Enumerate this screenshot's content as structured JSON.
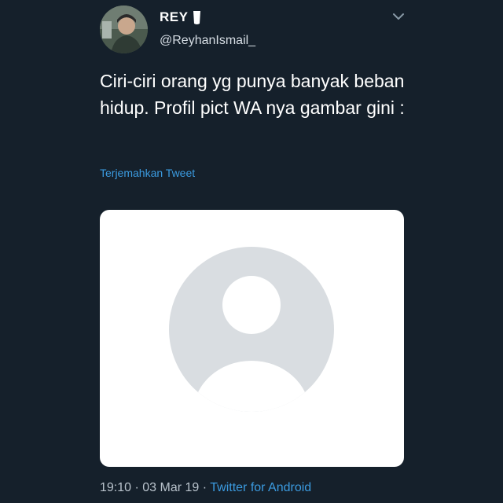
{
  "user": {
    "display_name": "REY",
    "name_emoji_icon": "cup-emoji-icon",
    "handle": "@ReyhanIsmail_"
  },
  "tweet": {
    "text": "Ciri-ciri orang yg punya banyak beban hidup. Profil pict WA nya gambar gini :",
    "translate_label": "Terjemahkan Tweet",
    "media_icon": "default-profile-placeholder-icon"
  },
  "footer": {
    "time": "19:10",
    "separator1": " · ",
    "date": "03 Mar 19",
    "separator2": " · ",
    "source": "Twitter for Android"
  },
  "colors": {
    "background": "#15202b",
    "link": "#3b9be0",
    "secondary_text": "#b9c3cc",
    "placeholder_gray": "#d9dde1"
  }
}
